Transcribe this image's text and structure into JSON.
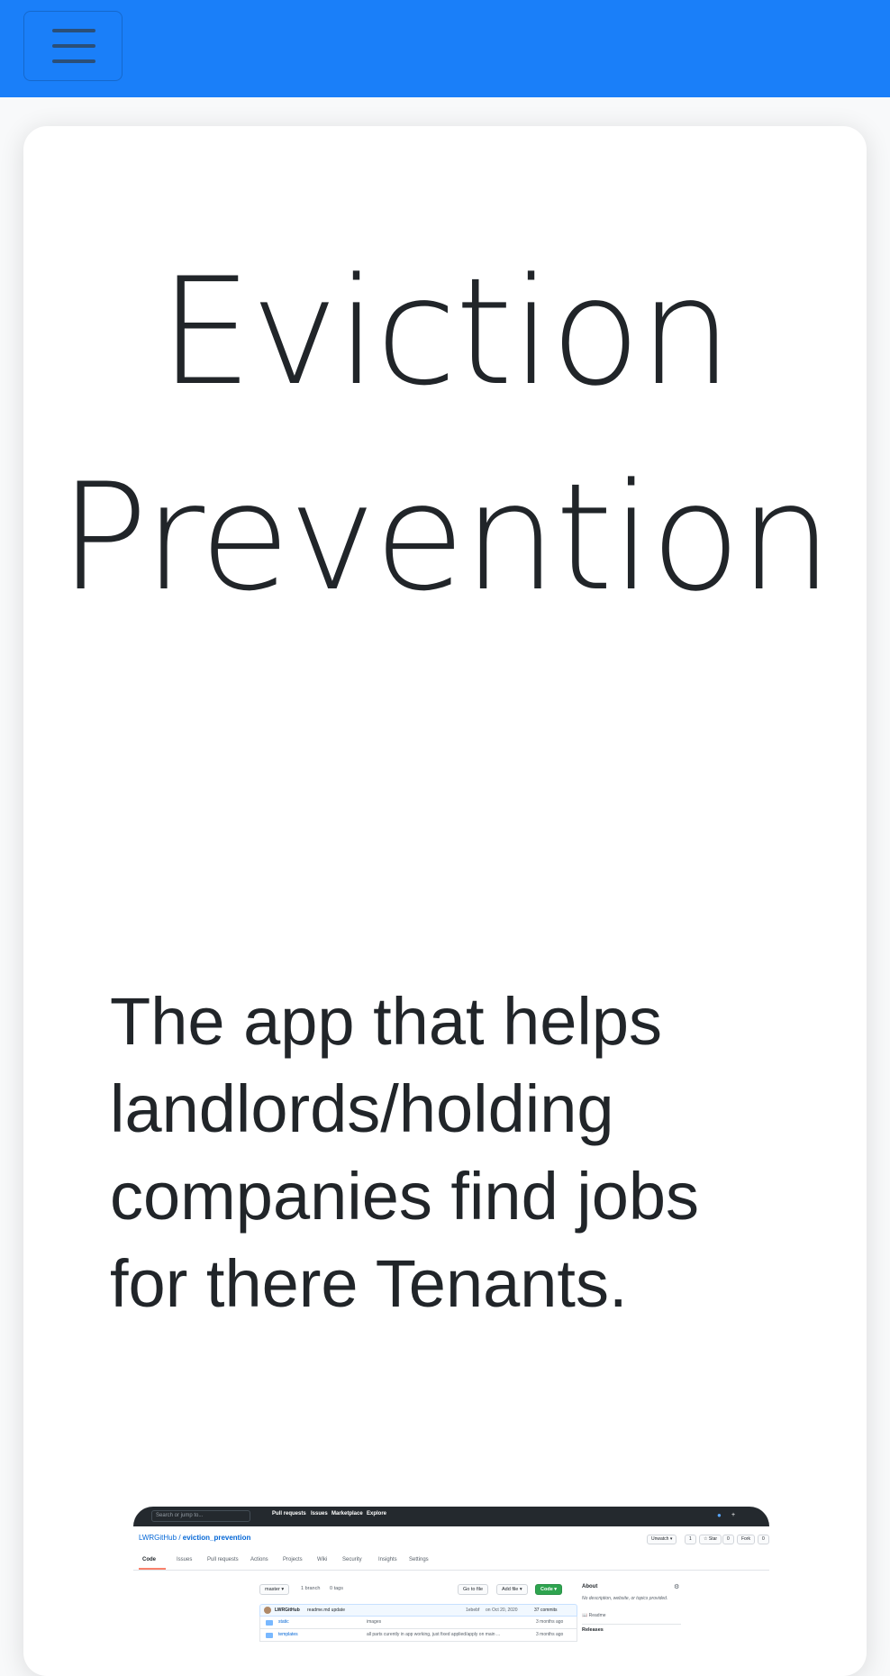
{
  "navbar": {
    "color": "#1a7ff9",
    "toggler_icon": "hamburger-menu-icon"
  },
  "hero": {
    "title_line1": "Eviction",
    "title_line2": "Prevention",
    "tagline": "The app that helps landlords/holding companies find jobs for there Tenants."
  },
  "screenshot": {
    "search_placeholder": "Search or jump to...",
    "top_nav": [
      "Pull requests",
      "Issues",
      "Marketplace",
      "Explore"
    ],
    "repo_owner": "LWRGitHub",
    "repo_sep": " / ",
    "repo_name": "eviction_prevention",
    "unwatch": "Unwatch ▾",
    "unwatch_count": "1",
    "star": "☆ Star",
    "star_count": "0",
    "fork": "Fork",
    "fork_count": "0",
    "tabs": [
      "Code",
      "Issues",
      "Pull requests",
      "Actions",
      "Projects",
      "Wiki",
      "Security",
      "Insights",
      "Settings"
    ],
    "branch": "master ▾",
    "branches": "1 branch",
    "tags": "0 tags",
    "go_to_file": "Go to file",
    "add_file": "Add file ▾",
    "code_button": "Code ▾",
    "commit_author": "LWRGitHub",
    "commit_msg": "readme.md update",
    "commit_hash": "1ebebf",
    "commit_date": "on Oct 20, 2020",
    "commit_count": "37 commits",
    "files": [
      {
        "name": "static",
        "message": "images",
        "age": "3 months ago"
      },
      {
        "name": "templates",
        "message": "all parts curently in app working, just fixed applied/apply on main ...",
        "age": "3 months ago"
      }
    ],
    "about_title": "About",
    "about_desc": "No description, website, or topics provided.",
    "readme": "Readme",
    "releases": "Releases"
  }
}
